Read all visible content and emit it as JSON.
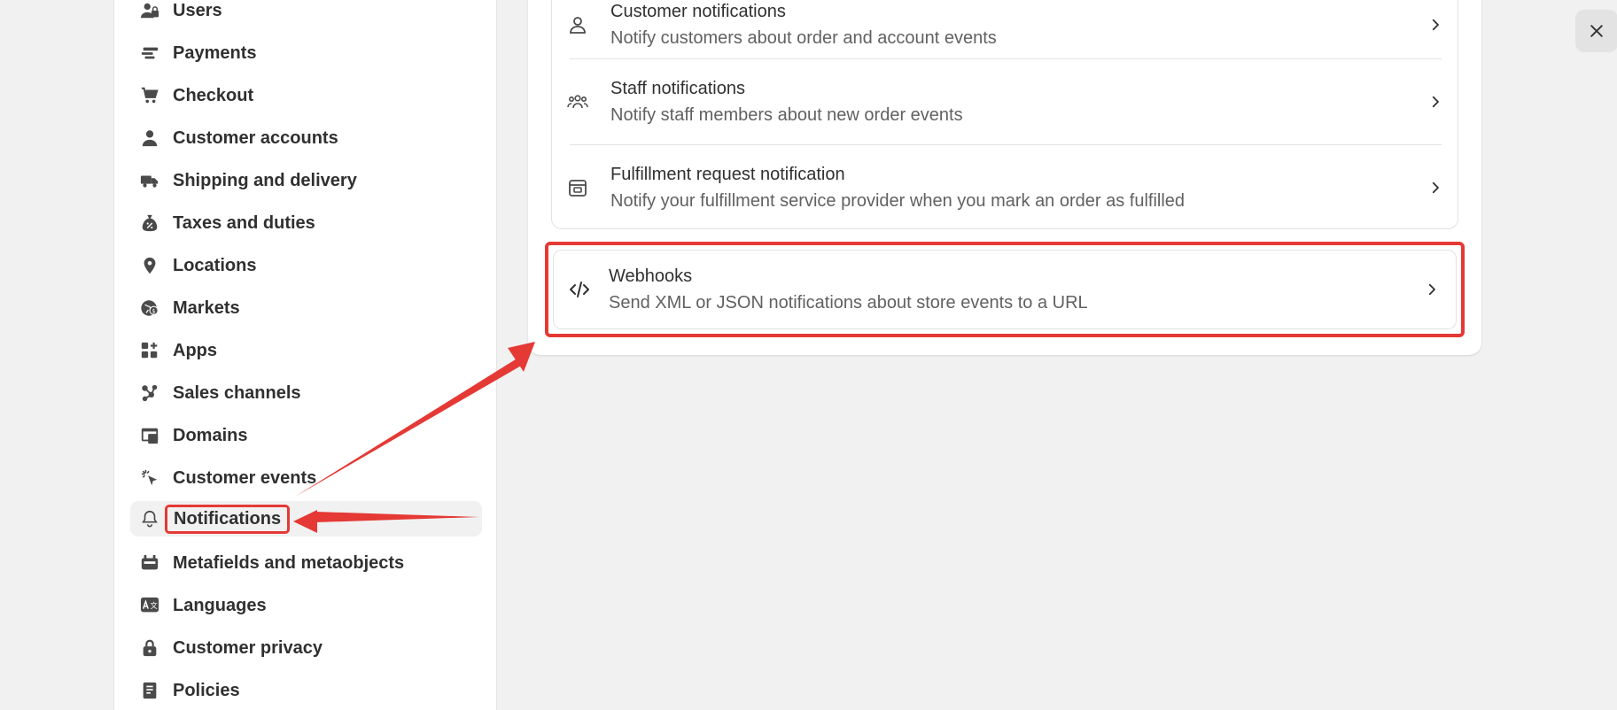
{
  "sidebar": {
    "items": [
      {
        "label": "Users",
        "icon": "users-icon"
      },
      {
        "label": "Payments",
        "icon": "payments-icon"
      },
      {
        "label": "Checkout",
        "icon": "cart-icon"
      },
      {
        "label": "Customer accounts",
        "icon": "person-icon"
      },
      {
        "label": "Shipping and delivery",
        "icon": "truck-icon"
      },
      {
        "label": "Taxes and duties",
        "icon": "tax-icon"
      },
      {
        "label": "Locations",
        "icon": "location-pin-icon"
      },
      {
        "label": "Markets",
        "icon": "globe-icon"
      },
      {
        "label": "Apps",
        "icon": "apps-icon"
      },
      {
        "label": "Sales channels",
        "icon": "sales-channels-icon"
      },
      {
        "label": "Domains",
        "icon": "domains-icon"
      },
      {
        "label": "Customer events",
        "icon": "cursor-click-icon"
      },
      {
        "label": "Notifications",
        "icon": "bell-icon",
        "active": true
      },
      {
        "label": "Metafields and metaobjects",
        "icon": "metafields-icon"
      },
      {
        "label": "Languages",
        "icon": "translate-icon"
      },
      {
        "label": "Customer privacy",
        "icon": "lock-icon"
      },
      {
        "label": "Policies",
        "icon": "policies-icon"
      }
    ]
  },
  "main": {
    "rows": [
      {
        "title": "Customer notifications",
        "description": "Notify customers about order and account events",
        "icon": "person-outline-icon"
      },
      {
        "title": "Staff notifications",
        "description": "Notify staff members about new order events",
        "icon": "team-icon"
      },
      {
        "title": "Fulfillment request notification",
        "description": "Notify your fulfillment service provider when you mark an order as fulfilled",
        "icon": "store-box-icon"
      }
    ],
    "webhooks": {
      "title": "Webhooks",
      "description": "Send XML or JSON notifications about store events to a URL",
      "icon": "code-icon"
    }
  },
  "colors": {
    "annotation": "#e53935",
    "background": "#f1f1f1",
    "card": "#ffffff",
    "text_primary": "#303030",
    "text_secondary": "#616161"
  },
  "close_button": {
    "icon": "close-icon"
  }
}
